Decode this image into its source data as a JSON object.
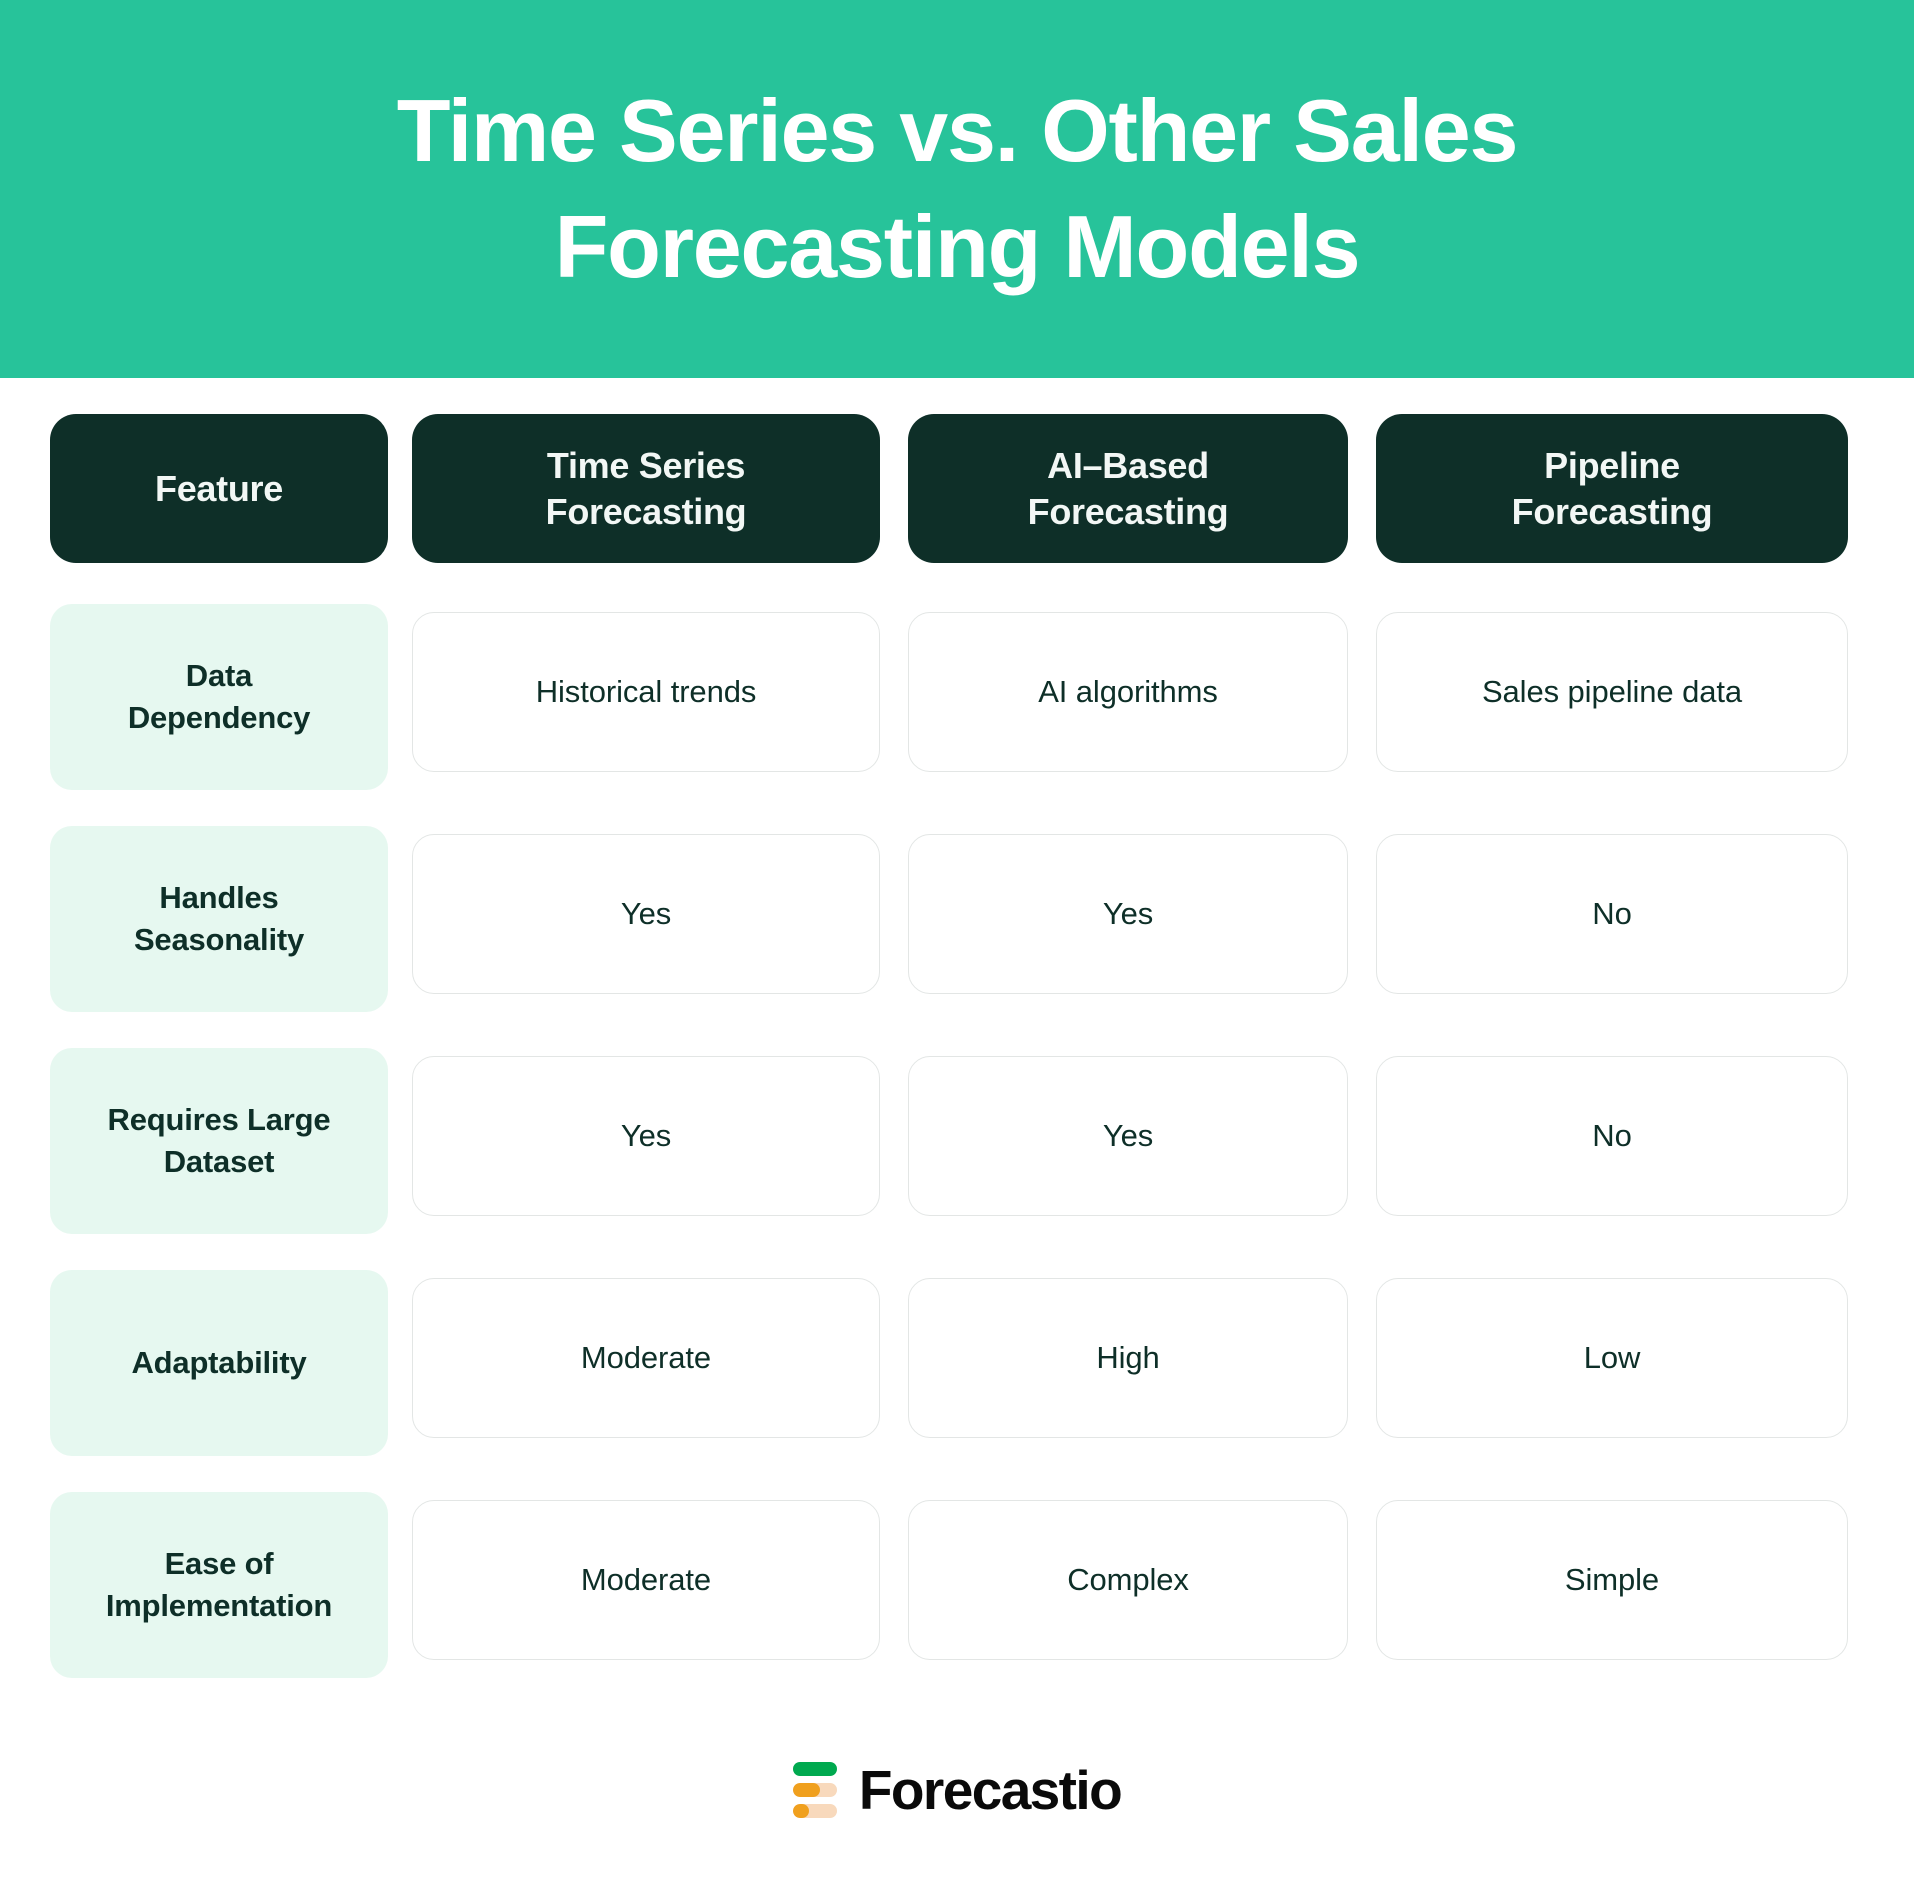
{
  "banner": {
    "title": "Time Series vs. Other Sales\nForecasting Models",
    "background_color": "#27C39A",
    "text_color": "#FFFFFF"
  },
  "colors": {
    "accent_green": "#27C39A",
    "header_pill": "#0E2F28",
    "feature_pill": "#E6F8F0",
    "cell_border": "#E3E6E5",
    "text_dark": "#0E2F28",
    "logo_green": "#00A94F",
    "logo_orange": "#F0A01E",
    "logo_peach": "#F8D9BC"
  },
  "table": {
    "headers": [
      "Feature",
      "Time Series\nForecasting",
      "AI–Based\nForecasting",
      "Pipeline\nForecasting"
    ],
    "rows": [
      {
        "feature": "Data\nDependency",
        "time_series": "Historical trends",
        "ai_based": "AI algorithms",
        "pipeline": "Sales pipeline data"
      },
      {
        "feature": "Handles\nSeasonality",
        "time_series": "Yes",
        "ai_based": "Yes",
        "pipeline": "No"
      },
      {
        "feature": "Requires Large\nDataset",
        "time_series": "Yes",
        "ai_based": "Yes",
        "pipeline": "No"
      },
      {
        "feature": "Adaptability",
        "time_series": "Moderate",
        "ai_based": "High",
        "pipeline": "Low"
      },
      {
        "feature": "Ease of\nImplementation",
        "time_series": "Moderate",
        "ai_based": "Complex",
        "pipeline": "Simple"
      }
    ]
  },
  "footer": {
    "brand": "Forecastio",
    "logo_icon": "forecastio-bars-logo"
  }
}
